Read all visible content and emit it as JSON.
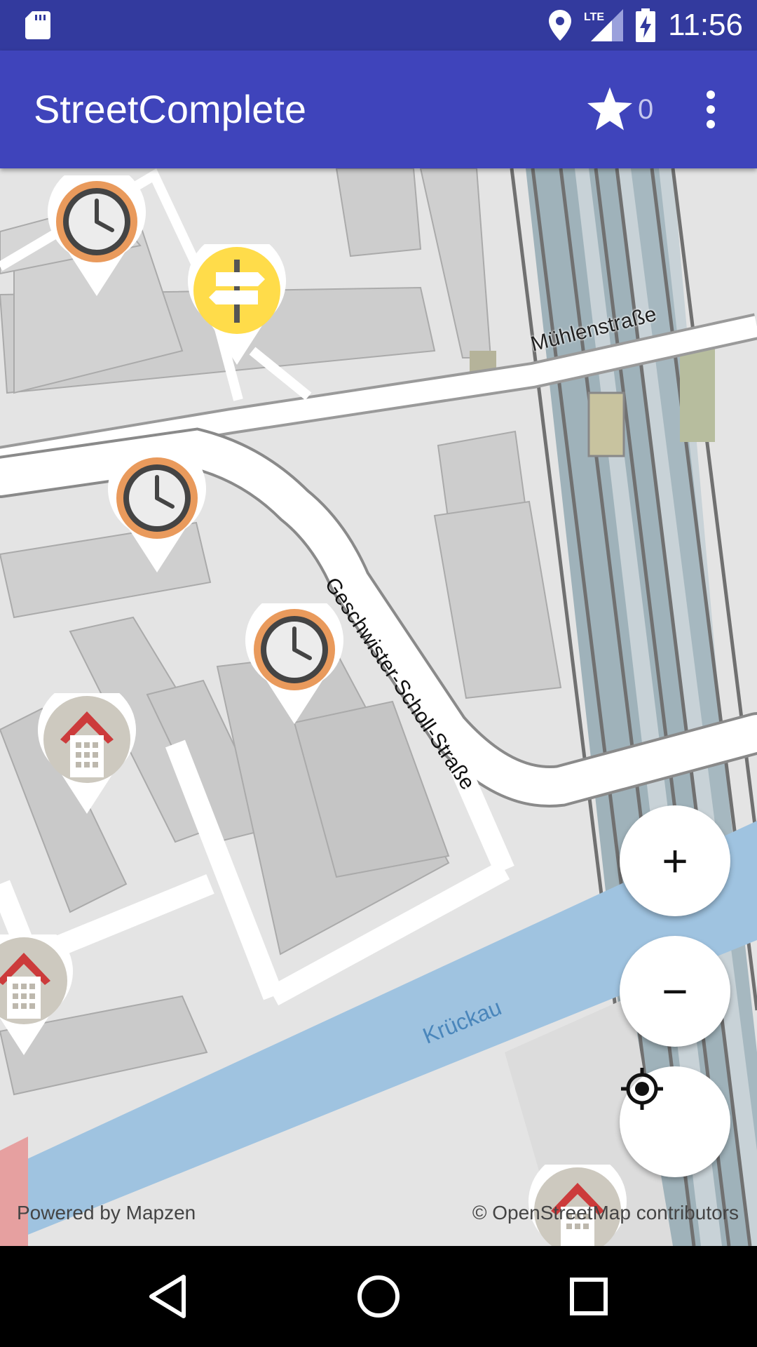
{
  "status_bar": {
    "time": "11:56",
    "network": "LTE",
    "icons": [
      "sd-card-icon",
      "location-icon",
      "signal-icon",
      "battery-charging-icon"
    ]
  },
  "app_bar": {
    "title": "StreetComplete",
    "star_count": "0",
    "icons": [
      "star-icon",
      "more-vert-icon"
    ]
  },
  "map": {
    "street_labels": [
      "Mühlenstraße",
      "Geschwister-Scholl-Straße"
    ],
    "water_label": "Krückau",
    "quest_pins": [
      "opening-hours-quest",
      "direction-sign-quest",
      "opening-hours-quest",
      "opening-hours-quest",
      "building-quest",
      "building-quest",
      "building-quest"
    ],
    "attribution_left": "Powered by Mapzen",
    "attribution_right": "© OpenStreetMap contributors"
  },
  "controls": {
    "zoom_in": "+",
    "zoom_out": "−",
    "locate": "my-location-icon"
  },
  "nav_bar": {
    "icons": [
      "back-icon",
      "home-icon",
      "recents-icon"
    ]
  },
  "colors": {
    "status_bar": "#333a9e",
    "app_bar": "#3f44bb",
    "water": "#9fc3e0",
    "pin_orange": "#e99a5c",
    "pin_yellow": "#ffdc4a",
    "building_red": "#cc3b3b"
  }
}
